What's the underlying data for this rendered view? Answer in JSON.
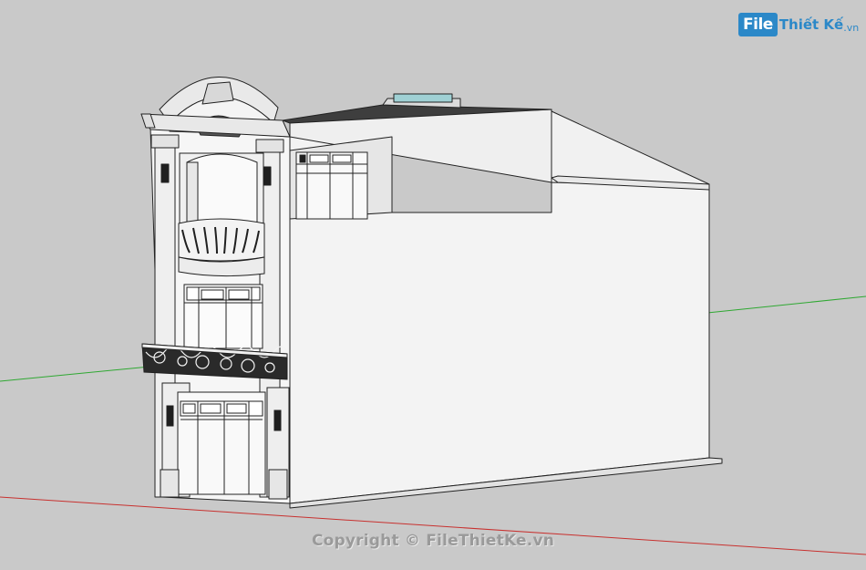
{
  "viewport": {
    "name": "SketchUp 3D model viewport",
    "background_color": "#c9c9c9",
    "axis_colors": {
      "green_axis": "#2fa832",
      "red_axis": "#c8312f"
    }
  },
  "watermark": {
    "logo_box": "File",
    "logo_rest": "Thiết Kế",
    "logo_tld": ".vn",
    "copyright": "Copyright © FileThietKe.vn"
  },
  "model": {
    "description_icon": "townhouse-3d-model",
    "wall_color": "#f4f4f4",
    "shadow_wall_color": "#ededed",
    "glass_color": "#ffffff",
    "skylight_color": "#9fd0d4",
    "ironwork_color": "#1f1f1f"
  }
}
